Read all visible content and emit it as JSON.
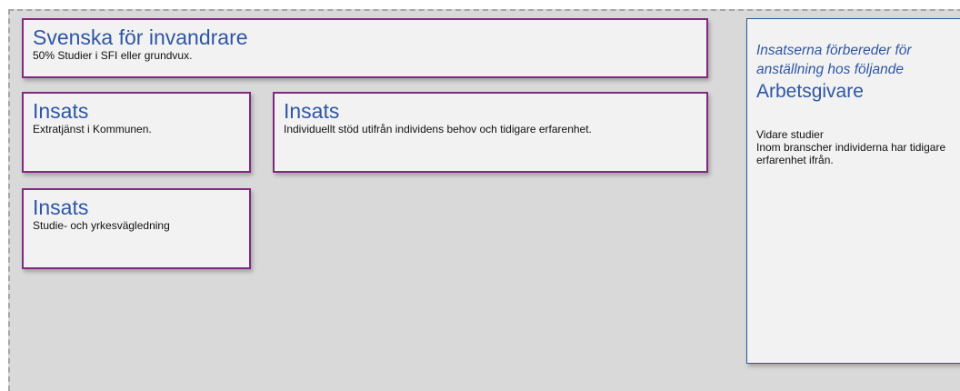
{
  "main_card": {
    "title": "Svenska för invandrare",
    "description": "50% Studier i SFI eller grundvux."
  },
  "insats_cards": [
    {
      "title": "Insats",
      "description": "Extratjänst i Kommunen."
    },
    {
      "title": "Insats",
      "description": "Individuellt stöd utifrån individens behov och tidigare erfarenhet."
    },
    {
      "title": "Insats",
      "description": "Studie- och yrkesvägledning"
    }
  ],
  "side_panel": {
    "intro": "Insatserna förbereder för anställning hos följande",
    "heading": "Arbetsgivare",
    "line1": "Vidare studier",
    "line2": "Inom branscher individerna har tidigare erfarenhet ifrån."
  },
  "colors": {
    "card_border": "#7f2a7f",
    "title_blue": "#2e56a6",
    "canvas_bg": "#d9d9d9",
    "card_bg": "#f2f2f2"
  }
}
